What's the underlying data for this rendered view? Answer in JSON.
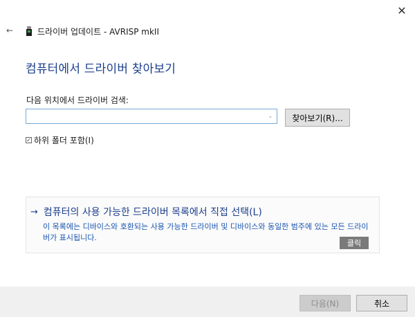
{
  "window": {
    "title": "드라이버 업데이트 - AVRISP mkII",
    "close_glyph": "✕",
    "back_glyph": "←",
    "icons": {
      "back": "back-arrow-icon",
      "device": "usb-device-icon",
      "close": "close-icon"
    }
  },
  "page": {
    "heading": "컴퓨터에서 드라이버 찾아보기"
  },
  "search": {
    "label": "다음 위치에서 드라이버 검색:",
    "path_value": "",
    "dropdown_glyph": "⌄",
    "browse_label": "찾아보기(R)..."
  },
  "subfolders": {
    "checked": true,
    "check_glyph": "✓",
    "label": "하위 폴더 포함(I)"
  },
  "pick_from_list": {
    "arrow_glyph": "→",
    "title": "컴퓨터의 사용 가능한 드라이버 목록에서 직접 선택(L)",
    "description": "이 목록에는 디바이스와 호환되는 사용 가능한 드라이버 및 디바이스와 동일한 범주에 있는 모든 드라이버가 표시됩니다.",
    "click_badge": "클릭"
  },
  "footer": {
    "next_label": "다음(N)",
    "next_enabled": false,
    "cancel_label": "취소"
  },
  "colors": {
    "heading": "#1c3f8c",
    "link_desc": "#1a56b0",
    "footer_bg": "#f0f0f0",
    "input_border": "#7aa7d8",
    "badge_bg": "#7a7a7a"
  }
}
